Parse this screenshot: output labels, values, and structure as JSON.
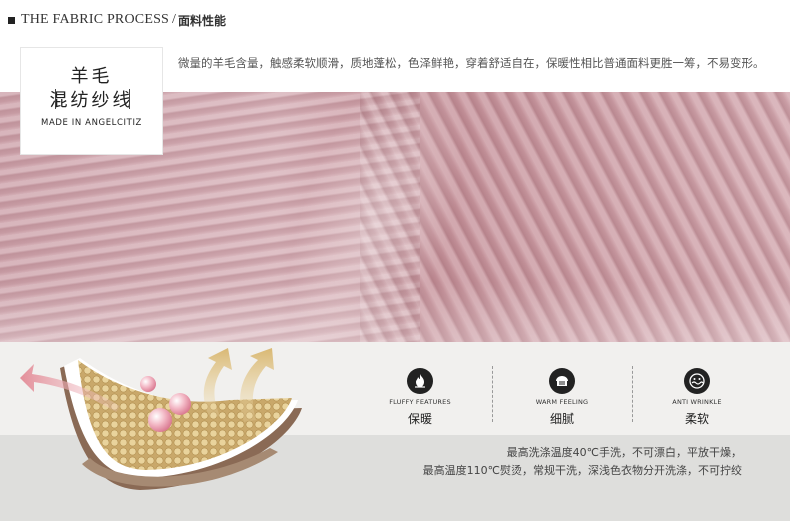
{
  "header": {
    "title_en": "THE FABRIC PROCESS",
    "separator": "/",
    "title_cn": "面料性能"
  },
  "badge": {
    "line1": "羊毛",
    "line2": "混纺纱线",
    "made_in": "MADE IN ANGELCITIZ"
  },
  "description": "微量的羊毛含量，触感柔软顺滑，质地蓬松，色泽鲜艳，穿着舒适自在，保暖性相比普通面料更胜一筹，不易变形。",
  "features": [
    {
      "icon": "flame-icon",
      "en": "FLUFFY FEATURES",
      "cn": "保暖"
    },
    {
      "icon": "bread-icon",
      "en": "WARM FEELING",
      "cn": "细腻"
    },
    {
      "icon": "face-wave-icon",
      "en": "ANTI WRINKLE",
      "cn": "柔软"
    }
  ],
  "care": {
    "line1": "最高洗涤温度40℃手洗，不可漂白，平放干燥，",
    "line2": "最高温度110℃熨烫，常规干洗，深浅色衣物分开洗涤，不可拧绞"
  },
  "colors": {
    "fabric_pink": "#d4aab1",
    "panel": "#f1f0ee",
    "band": "#dededc",
    "arrow_pink": "#e8a6ae",
    "arrow_gold": "#e2c58a"
  }
}
